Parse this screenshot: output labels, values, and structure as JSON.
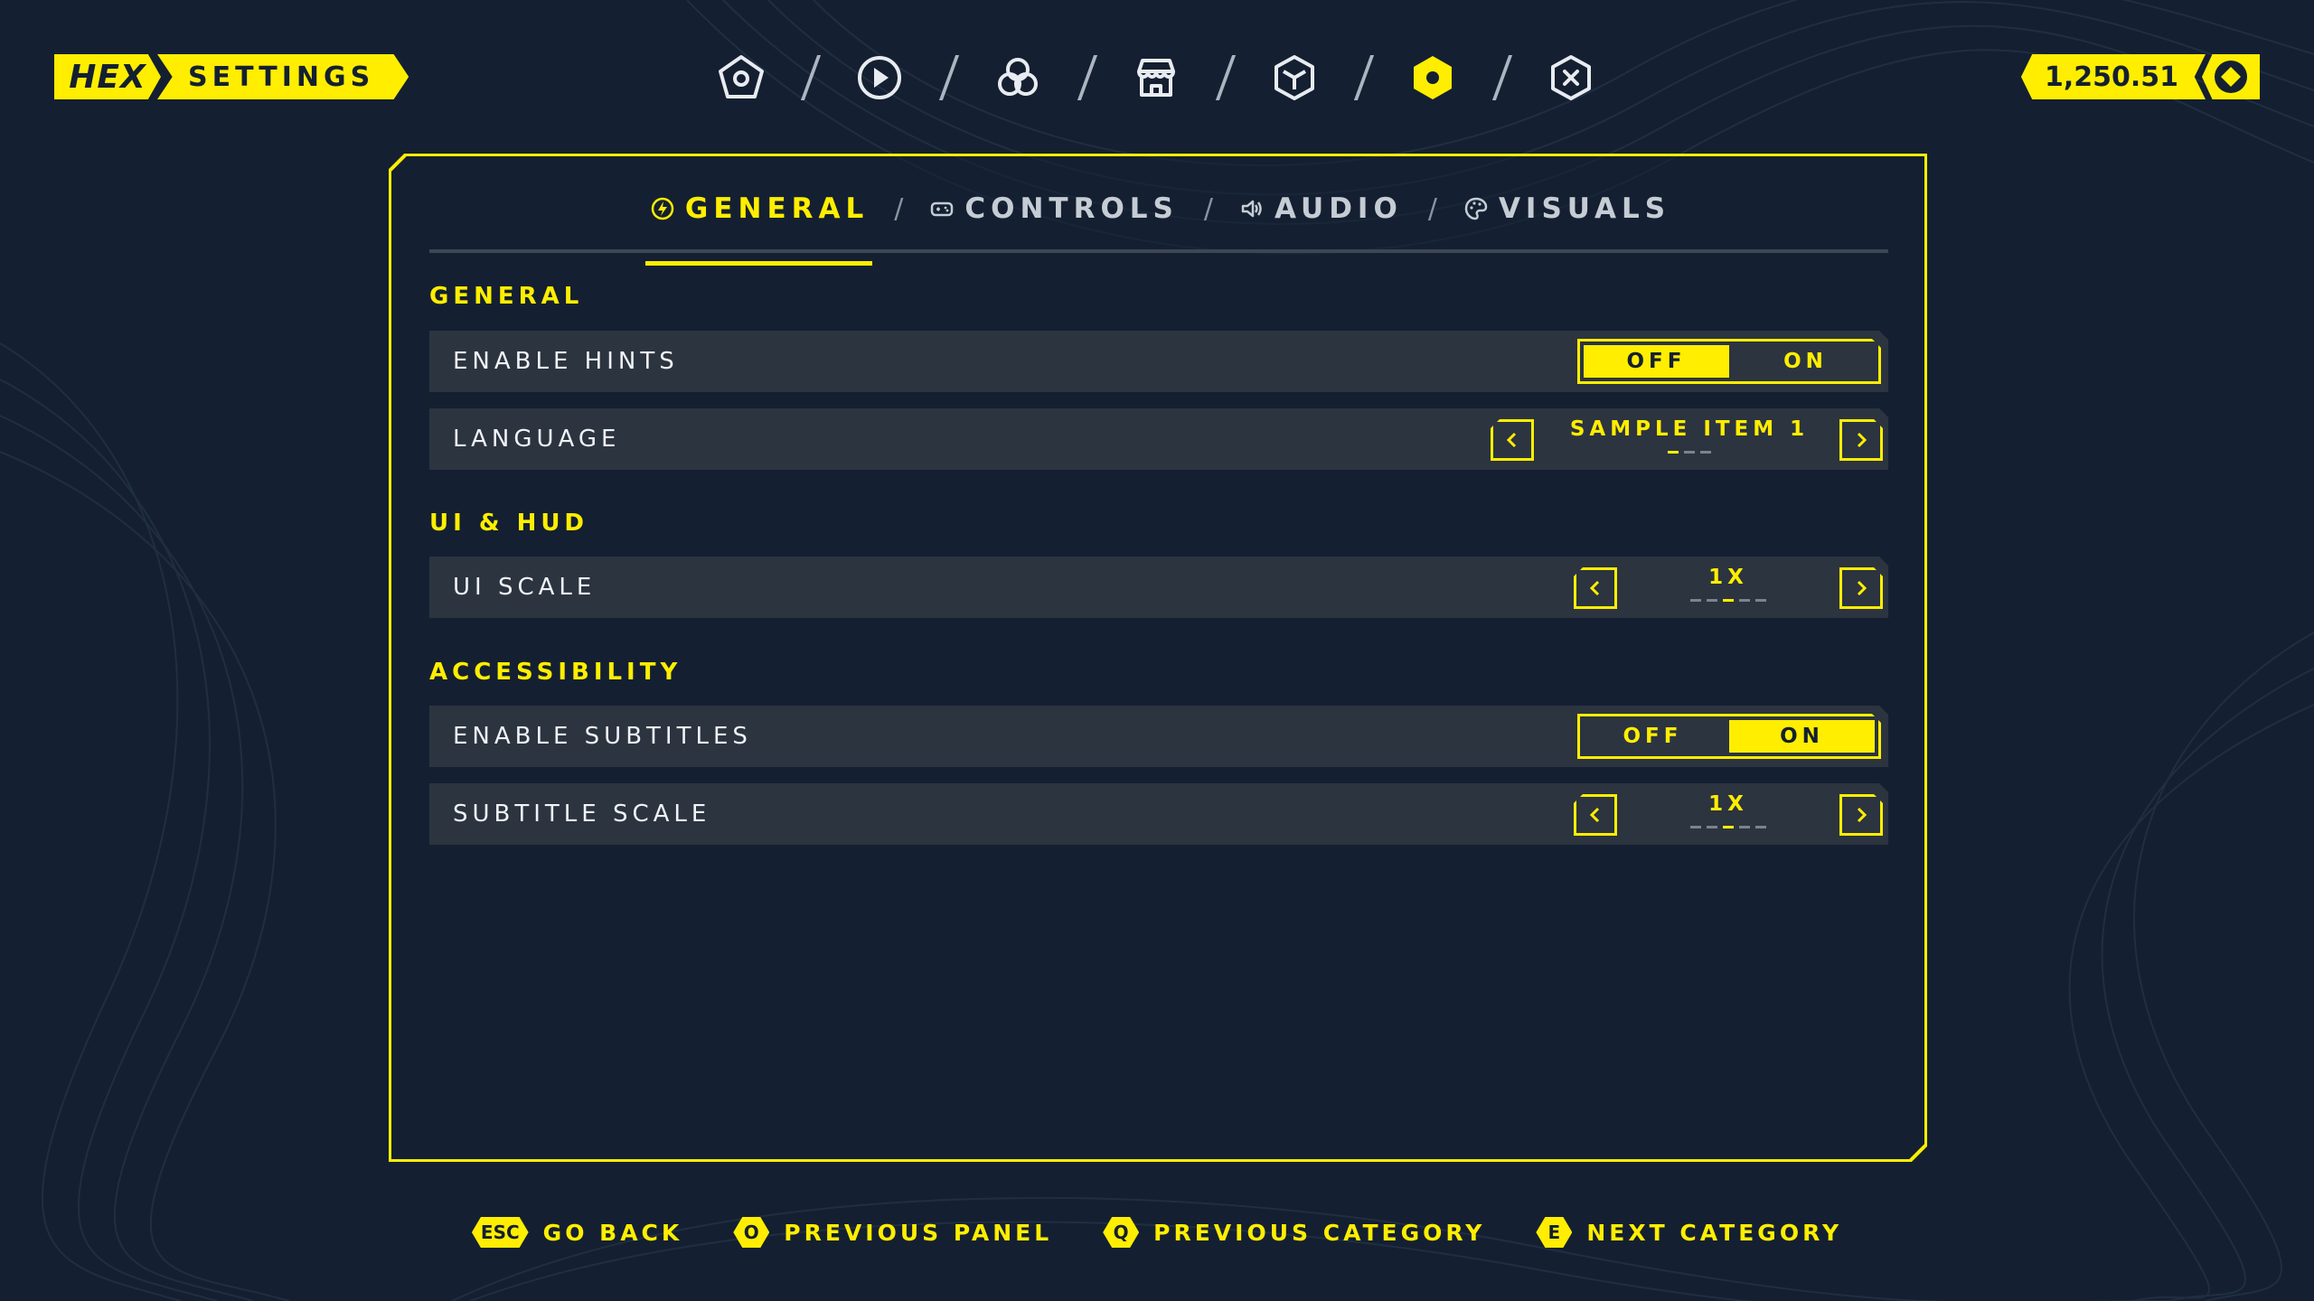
{
  "header": {
    "brand_hex": "HEX",
    "brand_title": "SETTINGS",
    "currency_value": "1,250.51",
    "currency_icon": "coin-icon",
    "nav_icons": [
      "home-pentagon-icon",
      "play-icon",
      "social-circles-icon",
      "store-icon",
      "cube-icon",
      "settings-hex-icon",
      "close-hex-icon"
    ],
    "active_nav": "settings-hex-icon"
  },
  "tabs": [
    {
      "label": "GENERAL",
      "icon": "bolt-icon",
      "active": true
    },
    {
      "label": "CONTROLS",
      "icon": "gamepad-icon",
      "active": false
    },
    {
      "label": "AUDIO",
      "icon": "speaker-icon",
      "active": false
    },
    {
      "label": "VISUALS",
      "icon": "palette-icon",
      "active": false
    }
  ],
  "tab_separator": "/",
  "sections": {
    "general": {
      "title": "GENERAL",
      "enable_hints": {
        "label": "ENABLE HINTS",
        "off": "OFF",
        "on": "ON",
        "selected": "OFF"
      },
      "language": {
        "label": "LANGUAGE",
        "value": "SAMPLE ITEM 1",
        "options_count": 3,
        "selected_index": 0
      }
    },
    "ui_hud": {
      "title": "UI & HUD",
      "ui_scale": {
        "label": "UI SCALE",
        "value": "1X",
        "options_count": 5,
        "selected_index": 2
      }
    },
    "accessibility": {
      "title": "ACCESSIBILITY",
      "enable_subtitles": {
        "label": "ENABLE SUBTITLES",
        "off": "OFF",
        "on": "ON",
        "selected": "ON"
      },
      "subtitle_scale": {
        "label": "SUBTITLE SCALE",
        "value": "1X",
        "options_count": 5,
        "selected_index": 2
      }
    }
  },
  "hints": [
    {
      "key": "ESC",
      "label": "GO BACK"
    },
    {
      "key": "O",
      "label": "PREVIOUS PANEL"
    },
    {
      "key": "Q",
      "label": "PREVIOUS CATEGORY"
    },
    {
      "key": "E",
      "label": "NEXT CATEGORY"
    }
  ],
  "colors": {
    "accent": "#ffee00",
    "background": "#142031",
    "row": "#2c3440",
    "text": "#f0f3f6"
  }
}
